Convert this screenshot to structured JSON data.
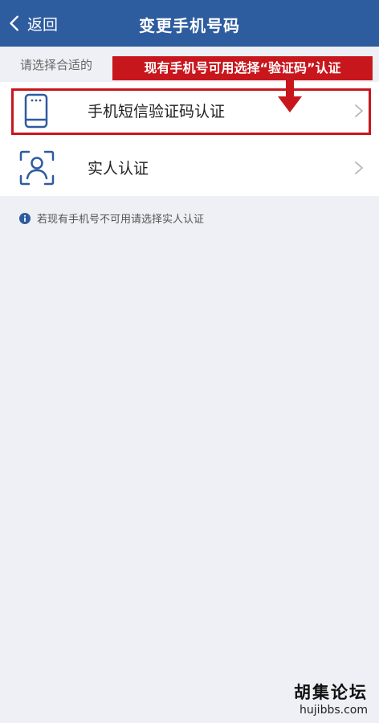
{
  "header": {
    "back_label": "返回",
    "title": "变更手机号码"
  },
  "hint_top": "请选择合适的",
  "options": [
    {
      "label": "手机短信验证码认证",
      "icon": "phone-icon"
    },
    {
      "label": "实人认证",
      "icon": "face-scan-icon"
    }
  ],
  "annotation": {
    "callout_text": "现有手机号可用选择“验证码”认证",
    "color": "#c8161d"
  },
  "footnote": "若现有手机号不可用请选择实人认证",
  "watermark": {
    "cn": "胡集论坛",
    "url": "hujibbs.com"
  },
  "colors": {
    "nav_bg": "#2d5c9f",
    "page_bg": "#eef0f5",
    "icon": "#2d5c9f"
  }
}
